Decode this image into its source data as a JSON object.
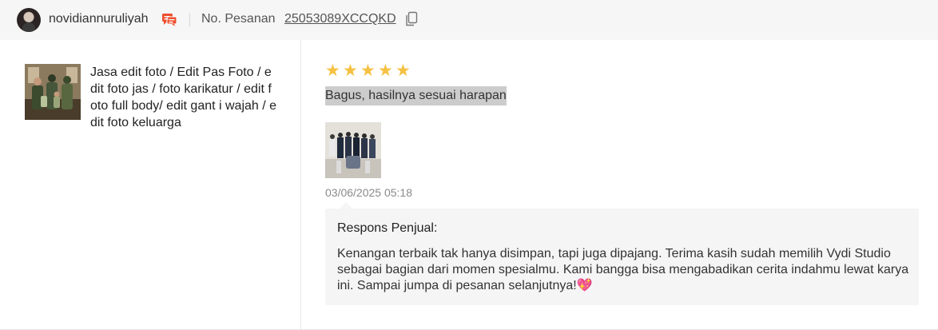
{
  "header": {
    "username": "novidiannuruliyah",
    "order_label": "No. Pesanan",
    "order_id": "25053089XCCQKD"
  },
  "product": {
    "name": "Jasa edit foto / Edit Pas Foto / edit foto jas / foto karikatur / edit foto full body/ edit gant i wajah / edit foto keluarga"
  },
  "review": {
    "rating": 5,
    "text": "Bagus, hasilnya sesuai harapan",
    "timestamp": "03/06/2025 05:18"
  },
  "seller_response": {
    "title": "Respons Penjual:",
    "body": "Kenangan terbaik tak hanya disimpan, tapi juga dipajang. Terima kasih sudah memilih Vydi Studio sebagai bagian dari momen spesialmu. Kami bangga bisa mengabadikan cerita indahmu lewat karya ini. Sampai jumpa di pesanan selanjutnya!",
    "emoji": "💖"
  },
  "colors": {
    "star": "#f6c142",
    "chat_icon": "#ee4d2d",
    "text_highlight": "#cccccc"
  }
}
